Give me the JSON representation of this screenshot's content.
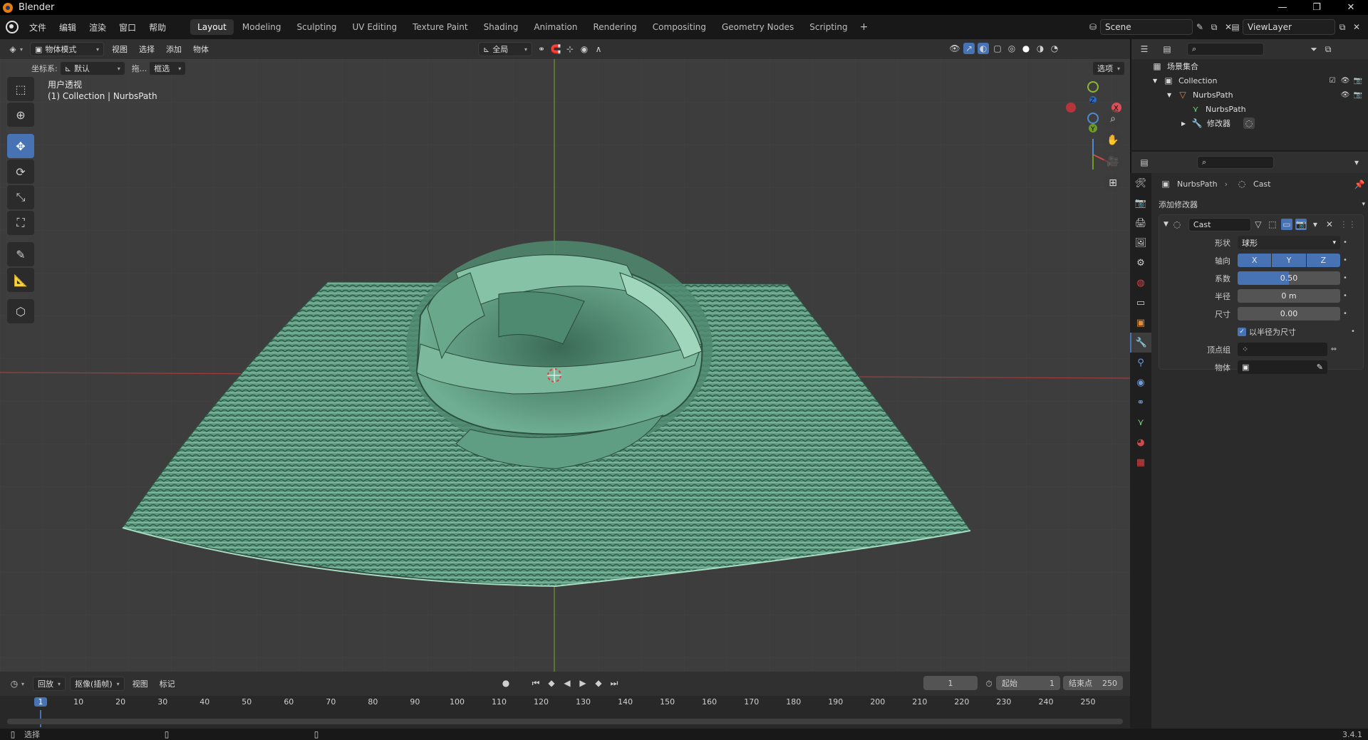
{
  "app": {
    "title": "Blender",
    "version": "3.4.1"
  },
  "menu": {
    "file": "文件",
    "edit": "编辑",
    "render": "渲染",
    "window": "窗口",
    "help": "帮助"
  },
  "workspaces": [
    "Layout",
    "Modeling",
    "Sculpting",
    "UV Editing",
    "Texture Paint",
    "Shading",
    "Animation",
    "Rendering",
    "Compositing",
    "Geometry Nodes",
    "Scripting"
  ],
  "active_workspace": "Layout",
  "scene": {
    "name": "Scene",
    "view_layer": "ViewLayer"
  },
  "viewport": {
    "mode": "物体模式",
    "menus": [
      "视图",
      "选择",
      "添加",
      "物体"
    ],
    "transform_orientation": "全局",
    "coord_label": "坐标系:",
    "coord_value": "默认",
    "drag_label": "拖...",
    "select_mode": "框选",
    "options": "选项",
    "view_name": "用户透视",
    "view_info": "(1) Collection | NurbsPath",
    "gizmo": {
      "x": "X",
      "y": "Y",
      "z": "Z"
    }
  },
  "timeline": {
    "playback": "回放",
    "keying": "抠像(插帧)",
    "view": "视图",
    "marker": "标记",
    "current_frame": "1",
    "start_label": "起始",
    "start": "1",
    "end_label": "结束点",
    "end": "250",
    "ticks": [
      "1",
      "10",
      "20",
      "30",
      "40",
      "50",
      "60",
      "70",
      "80",
      "90",
      "100",
      "110",
      "120",
      "130",
      "140",
      "150",
      "160",
      "170",
      "180",
      "190",
      "200",
      "210",
      "220",
      "230",
      "240",
      "250"
    ]
  },
  "statusbar": {
    "select": "选择"
  },
  "outliner": {
    "root": "场景集合",
    "collection": "Collection",
    "object": "NurbsPath",
    "data": "NurbsPath",
    "modifiers": "修改器"
  },
  "properties": {
    "breadcrumb_object": "NurbsPath",
    "breadcrumb_modifier": "Cast",
    "add_modifier": "添加修改器",
    "modifier_name": "Cast",
    "shape_label": "形状",
    "shape_value": "球形",
    "axis_label": "轴向",
    "axis_x": "X",
    "axis_y": "Y",
    "axis_z": "Z",
    "factor_label": "系数",
    "factor_value": "0.50",
    "radius_label": "半径",
    "radius_value": "0 m",
    "size_label": "尺寸",
    "size_value": "0.00",
    "use_radius_label": "以半径为尺寸",
    "vertex_group_label": "顶点组",
    "object_label": "物体"
  },
  "colors": {
    "accent": "#4772b3",
    "mesh": "#6fae92",
    "background": "#3d3d3d"
  }
}
